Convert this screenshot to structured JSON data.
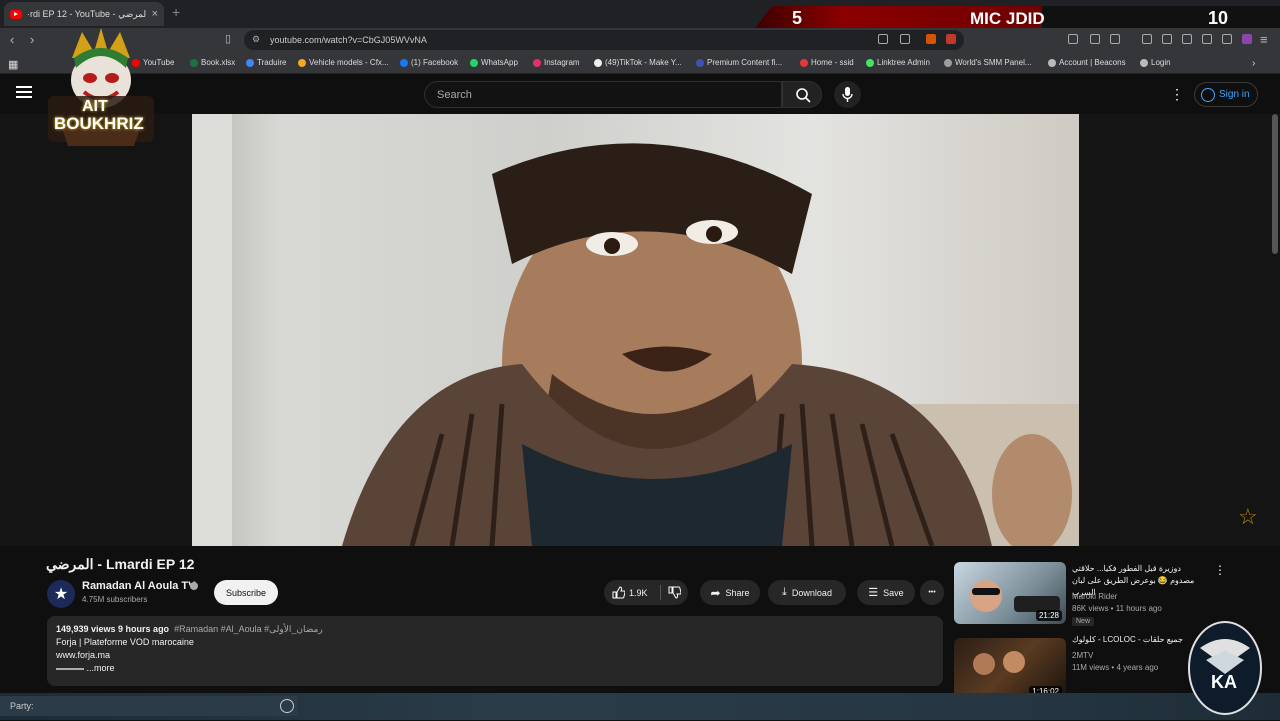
{
  "browser": {
    "tab_title": "·rdi EP 12 - YouTube - المرضي",
    "tab_close": "×",
    "new_tab": "+",
    "url": "youtube.com/watch?v=CbGJ05WVvNA"
  },
  "overlay": {
    "score_left": "5",
    "score_name": "MIC JDID",
    "score_right": "10",
    "logo_text_top": "AIT",
    "logo_text_bottom": "BOUKHRIZ",
    "ka_logo_text": "KA"
  },
  "bookmarks": [
    {
      "label": "YouTube",
      "color": "#ff0000"
    },
    {
      "label": "Book.xlsx",
      "color": "#1e7145"
    },
    {
      "label": "Traduire",
      "color": "#4285f4"
    },
    {
      "label": "Vehicle models - Cfx...",
      "color": "#f5a623"
    },
    {
      "label": "(1) Facebook",
      "color": "#1877f2"
    },
    {
      "label": "WhatsApp",
      "color": "#25d366"
    },
    {
      "label": "Instagram",
      "color": "#e1306c"
    },
    {
      "label": "(49)TikTok - Make Y...",
      "color": "#eeeeee"
    },
    {
      "label": "Premium Content fi...",
      "color": "#3f51b5"
    },
    {
      "label": "Home - ssid",
      "color": "#e53935"
    },
    {
      "label": "Linktree Admin",
      "color": "#43e660"
    },
    {
      "label": "World's SMM Panel...",
      "color": "#9e9e9e"
    },
    {
      "label": "Account | Beacons",
      "color": "#bbbbbb"
    },
    {
      "label": "Login",
      "color": "#bbbbbb"
    }
  ],
  "youtube": {
    "search_placeholder": "Search",
    "sign_in": "Sign in",
    "video_title": "المرضي - Lmardi EP 12",
    "channel_name": "Ramadan Al Aoula TV",
    "subscribers": "4.75M subscribers",
    "subscribe": "Subscribe",
    "likes": "1.9K",
    "share": "Share",
    "download": "Download",
    "save": "Save",
    "more": "•••",
    "description": {
      "meta": "149,939 views  9 hours ago",
      "tags": "#Ramadan #Al_Aoula #رمضان_الأولى",
      "line2": "Forja | Plateforme VOD marocaine",
      "line3": "www.forja.ma",
      "more": "...more"
    },
    "recommendations": [
      {
        "title": "دوزيرة قبل الفطور فكيا... حلاقتي مصدوم 😂 بوعرض الطريق على لبان السرب",
        "channel": "Maroki Rider",
        "views": "86K views • 11 hours ago",
        "badge": "New",
        "duration": "21:28"
      },
      {
        "title": "كلولوك - LCOLOC - جميع حلقات",
        "channel": "2MTV",
        "views": "11M views • 4 years ago",
        "duration": "1:16:02"
      }
    ]
  },
  "taskbar": {
    "party_label": "Party:"
  }
}
